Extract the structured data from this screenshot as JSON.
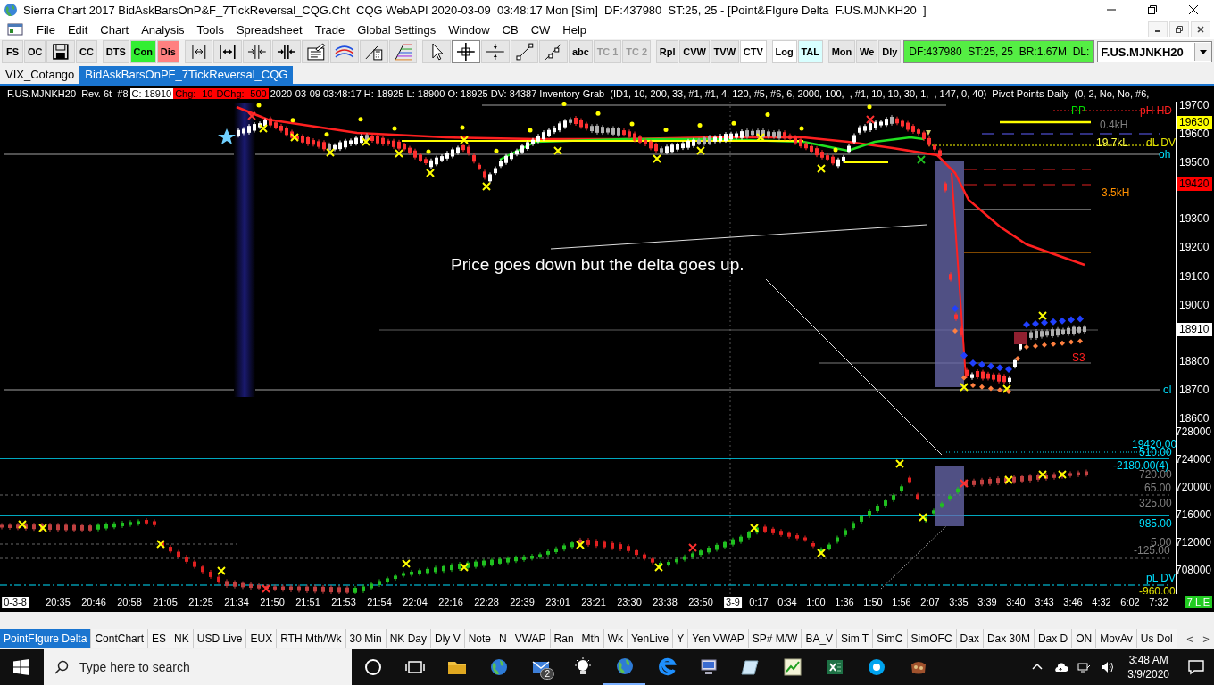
{
  "window": {
    "title": "Sierra Chart 2017 BidAskBarsOnP&F_7TickReversal_CQG.Cht  CQG WebAPI 2020-03-09  03:48:17 Mon [Sim]  DF:437980  ST:25, 25 - [Point&FIgure Delta  F.US.MJNKH20  ]"
  },
  "menu": [
    "File",
    "Edit",
    "Chart",
    "Analysis",
    "Tools",
    "Spreadsheet",
    "Trade",
    "Global Settings",
    "Window",
    "CB",
    "CW",
    "Help"
  ],
  "toolbar": [
    {
      "kind": "text",
      "label": "FS",
      "on": false,
      "disabled": false
    },
    {
      "kind": "text",
      "label": "OC",
      "on": false,
      "disabled": false
    },
    {
      "kind": "icon",
      "selected": false
    },
    {
      "kind": "text",
      "label": "CC",
      "on": false,
      "disabled": false
    },
    {
      "kind": "separator"
    },
    {
      "kind": "text",
      "label": "DTS",
      "on": false,
      "disabled": false
    },
    {
      "kind": "text",
      "label": "Con",
      "on": false,
      "disabled": false,
      "color": "#33ee33"
    },
    {
      "kind": "text",
      "label": "Dis",
      "on": false,
      "disabled": false,
      "color": "#ff8080"
    },
    {
      "kind": "separator"
    },
    {
      "kind": "icon",
      "selected": false
    },
    {
      "kind": "icon",
      "selected": false
    },
    {
      "kind": "icon",
      "selected": false
    },
    {
      "kind": "icon",
      "selected": false
    },
    {
      "kind": "icon",
      "selected": false
    },
    {
      "kind": "icon",
      "selected": false
    },
    {
      "kind": "icon",
      "selected": false
    },
    {
      "kind": "icon",
      "selected": false
    },
    {
      "kind": "separator"
    },
    {
      "kind": "icon",
      "selected": false
    },
    {
      "kind": "icon",
      "selected": true
    },
    {
      "kind": "icon",
      "selected": false
    },
    {
      "kind": "icon",
      "selected": false
    },
    {
      "kind": "icon",
      "selected": false
    },
    {
      "kind": "text",
      "label": "abc",
      "on": false,
      "disabled": false
    },
    {
      "kind": "text",
      "label": "TC 1",
      "on": false,
      "disabled": true
    },
    {
      "kind": "text",
      "label": "TC 2",
      "on": false,
      "disabled": true
    },
    {
      "kind": "separator"
    },
    {
      "kind": "text",
      "label": "Rpl",
      "on": false,
      "disabled": false
    },
    {
      "kind": "text",
      "label": "CVW",
      "on": false,
      "disabled": false
    },
    {
      "kind": "text",
      "label": "TVW",
      "on": false,
      "disabled": false
    },
    {
      "kind": "text",
      "label": "CTV",
      "on": true,
      "disabled": false
    },
    {
      "kind": "separator"
    },
    {
      "kind": "text",
      "label": "Log",
      "on": true,
      "disabled": false
    },
    {
      "kind": "text",
      "label": "TAL",
      "on": false,
      "disabled": false,
      "color": "#d8ffff"
    },
    {
      "kind": "separator"
    },
    {
      "kind": "text",
      "label": "Mon",
      "on": false,
      "disabled": false
    },
    {
      "kind": "text",
      "label": "We",
      "on": false,
      "disabled": false
    },
    {
      "kind": "text",
      "label": "Dly",
      "on": false,
      "disabled": false
    }
  ],
  "status": "DF:437980  ST:25, 25  BR:1.67M  DL:",
  "symbol": "F.US.MJNKH20",
  "chart_tabs": [
    {
      "label": "VIX_Cotango",
      "selected": false
    },
    {
      "label": "BidAskBarsOnPF_7TickReversal_CQG",
      "selected": true
    }
  ],
  "chart_header": [
    {
      "kind": "plain",
      "text": "F.US.MJNKH20  Rev. 6t  #8"
    },
    {
      "kind": "highlight",
      "text": "C: 18910"
    },
    {
      "kind": "alert",
      "text": "Chg: -10"
    },
    {
      "kind": "alert",
      "text": "DChg: -500"
    },
    {
      "kind": "plain",
      "text": "2020-03-09 03:48:17 H: 18925 L: 18900 O: 18925 DV: 84387 Inventory Grab  (ID1, 10, 200, 33, #1, #1, 4, 120, #5, #6, 6, 2000, 100,  , #1, 10, 10, 30, 1,  , 147, 0, 40)  Pivot Points-Daily  (0, 2, No, No, #6,"
    }
  ],
  "chart_labels": [
    {
      "text": "PP",
      "color": "#00dd00"
    },
    {
      "text": "pH HD",
      "color": "#ff2020"
    },
    {
      "text": "0.4kH",
      "color": "#808080"
    },
    {
      "text": "19.7kL",
      "color": "#ffff40"
    },
    {
      "text": "dL DV",
      "color": "#e0e000"
    },
    {
      "text": "oh",
      "color": "#00e0ff"
    },
    {
      "text": "3.5kH",
      "color": "#ff9000"
    },
    {
      "text": "S3",
      "color": "#ff2020"
    },
    {
      "text": "ol",
      "color": "#00e0ff"
    },
    {
      "text": "19420.00",
      "color": "#00e0ff"
    },
    {
      "text": "510.00",
      "color": "#00e0ff"
    },
    {
      "text": "-2180.00(4)",
      "color": "#00e0ff"
    },
    {
      "text": "720.00",
      "color": "#808080"
    },
    {
      "text": "65.00",
      "color": "#808080"
    },
    {
      "text": "325.00",
      "color": "#808080"
    },
    {
      "text": "985.00",
      "color": "#00e0ff"
    },
    {
      "text": "5.00",
      "color": "#808080"
    },
    {
      "text": "-125.00",
      "color": "#808080"
    },
    {
      "text": "pL DV",
      "color": "#00e0ff"
    },
    {
      "text": "-960.00",
      "color": "#e0e000"
    }
  ],
  "annotation": "Price goes down but the delta goes up.",
  "price_axis": {
    "labels": [
      "19700",
      "19600",
      "19500",
      "19300",
      "19200",
      "19100",
      "19000",
      "18800",
      "18700",
      "18600"
    ],
    "markers": [
      {
        "text": "19630",
        "color": "#ffff00"
      },
      {
        "text": "19420",
        "color": "#ff0000"
      },
      {
        "text": "18910",
        "color": "#ffffff"
      }
    ]
  },
  "delta_axis": {
    "labels": [
      "728000",
      "724000",
      "720000",
      "716000",
      "712000",
      "708000"
    ]
  },
  "time_axis": {
    "labels": [
      {
        "text": "0-3-8",
        "highlight": true
      },
      {
        "text": "20:35",
        "highlight": false
      },
      {
        "text": "20:46",
        "highlight": false
      },
      {
        "text": "20:58",
        "highlight": false
      },
      {
        "text": "21:05",
        "highlight": false
      },
      {
        "text": "21:25",
        "highlight": false
      },
      {
        "text": "21:34",
        "highlight": false
      },
      {
        "text": "21:50",
        "highlight": false
      },
      {
        "text": "21:51",
        "highlight": false
      },
      {
        "text": "21:53",
        "highlight": false
      },
      {
        "text": "21:54",
        "highlight": false
      },
      {
        "text": "22:04",
        "highlight": false
      },
      {
        "text": "22:16",
        "highlight": false
      },
      {
        "text": "22:28",
        "highlight": false
      },
      {
        "text": "22:39",
        "highlight": false
      },
      {
        "text": "23:01",
        "highlight": false
      },
      {
        "text": "23:21",
        "highlight": false
      },
      {
        "text": "23:30",
        "highlight": false
      },
      {
        "text": "23:38",
        "highlight": false
      },
      {
        "text": "23:50",
        "highlight": false
      },
      {
        "text": "3-9",
        "highlight": true
      },
      {
        "text": "0:17",
        "highlight": false
      },
      {
        "text": "0:34",
        "highlight": false
      },
      {
        "text": "1:00",
        "highlight": false
      },
      {
        "text": "1:36",
        "highlight": false
      },
      {
        "text": "1:50",
        "highlight": false
      },
      {
        "text": "1:56",
        "highlight": false
      },
      {
        "text": "2:07",
        "highlight": false
      },
      {
        "text": "3:35",
        "highlight": false
      },
      {
        "text": "3:39",
        "highlight": false
      },
      {
        "text": "3:40",
        "highlight": false
      },
      {
        "text": "3:43",
        "highlight": false
      },
      {
        "text": "3:46",
        "highlight": false
      },
      {
        "text": "4:32",
        "highlight": false
      },
      {
        "text": "6:02",
        "highlight": false
      },
      {
        "text": "7:32",
        "highlight": false
      }
    ],
    "badge": "7 L E"
  },
  "bottom_tabs": [
    {
      "label": "PointFIgure Delta",
      "selected": true
    },
    {
      "label": "ContChart",
      "selected": false
    },
    {
      "label": "ES",
      "selected": false
    },
    {
      "label": "NK",
      "selected": false
    },
    {
      "label": "USD Live",
      "selected": false
    },
    {
      "label": "EUX",
      "selected": false
    },
    {
      "label": "RTH Mth/Wk",
      "selected": false
    },
    {
      "label": "30 Min",
      "selected": false
    },
    {
      "label": "NK Day",
      "selected": false
    },
    {
      "label": "Dly V",
      "selected": false
    },
    {
      "label": "Note",
      "selected": false
    },
    {
      "label": "N",
      "selected": false
    },
    {
      "label": "VWAP",
      "selected": false
    },
    {
      "label": "Ran",
      "selected": false
    },
    {
      "label": "Mth",
      "selected": false
    },
    {
      "label": "Wk",
      "selected": false
    },
    {
      "label": "YenLive",
      "selected": false
    },
    {
      "label": "Y",
      "selected": false
    },
    {
      "label": "Yen VWAP",
      "selected": false
    },
    {
      "label": "SP# M/W",
      "selected": false
    },
    {
      "label": "BA_V",
      "selected": false
    },
    {
      "label": "Sim T",
      "selected": false
    },
    {
      "label": "SimC",
      "selected": false
    },
    {
      "label": "SimOFC",
      "selected": false
    },
    {
      "label": "Dax",
      "selected": false
    },
    {
      "label": "Dax 30M",
      "selected": false
    },
    {
      "label": "Dax D",
      "selected": false
    },
    {
      "label": "ON",
      "selected": false
    },
    {
      "label": "MovAv",
      "selected": false
    },
    {
      "label": "Us Dol",
      "selected": false
    }
  ],
  "tab_scroll": [
    "<",
    ">"
  ],
  "taskbar": {
    "search_placeholder": "Type here to search",
    "mail_badge": "2",
    "time": "3:48 AM",
    "date": "3/9/2020"
  }
}
